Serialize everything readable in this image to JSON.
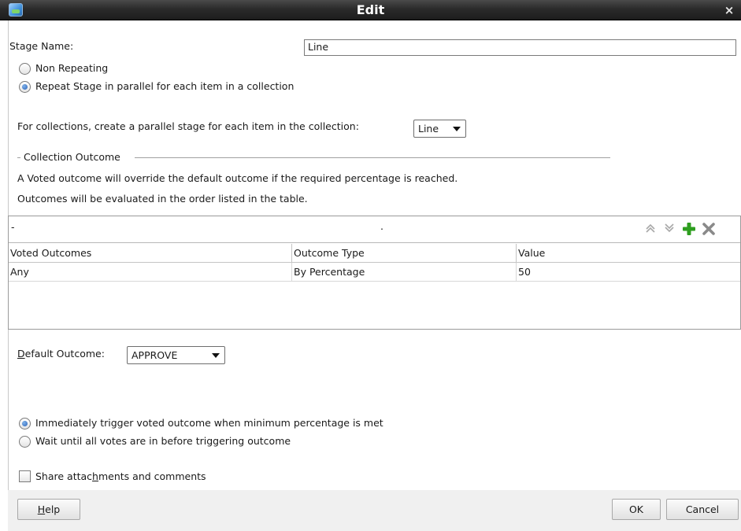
{
  "window": {
    "title": "Edit",
    "close_glyph": "×"
  },
  "stage_name": {
    "label": "Stage Name:",
    "value": "Line"
  },
  "repeat": {
    "option_non_repeating": "Non Repeating",
    "option_parallel": "Repeat Stage in parallel for each item in a collection",
    "selected": "parallel"
  },
  "collection": {
    "label": "For collections, create a parallel stage for each item in the collection:",
    "selected": "Line"
  },
  "collection_outcome": {
    "section_title": "Collection Outcome",
    "info_line1": "A Voted outcome will override the default outcome if the required percentage is reached.",
    "info_line2": "Outcomes will be evaluated in the order listed in the table."
  },
  "outcomes_table": {
    "toolbar_marks": [
      "-",
      "."
    ],
    "columns": [
      "Voted Outcomes",
      "Outcome Type",
      "Value"
    ],
    "rows": [
      [
        "Any",
        "By Percentage",
        "50"
      ]
    ]
  },
  "default_outcome": {
    "label_first": "D",
    "label_rest": "efault Outcome:",
    "selected": "APPROVE"
  },
  "trigger": {
    "option_immediate": "Immediately trigger voted outcome when minimum percentage is met",
    "option_wait": "Wait until all votes are in before triggering outcome",
    "selected": "immediate"
  },
  "share": {
    "label_before": "Share attac",
    "label_mnemonic": "h",
    "label_after": "ments and comments",
    "checked": false
  },
  "buttons": {
    "help_mnemonic": "H",
    "help_rest": "elp",
    "ok": "OK",
    "cancel": "Cancel"
  },
  "icons": {
    "move_up": "double-chevron-up-icon",
    "move_down": "double-chevron-down-icon",
    "add": "plus-icon",
    "delete": "x-icon"
  },
  "colors": {
    "add_icon": "#2e9e1f",
    "delete_icon": "#8a8a8a",
    "titlebar": "#2b2b2b"
  }
}
